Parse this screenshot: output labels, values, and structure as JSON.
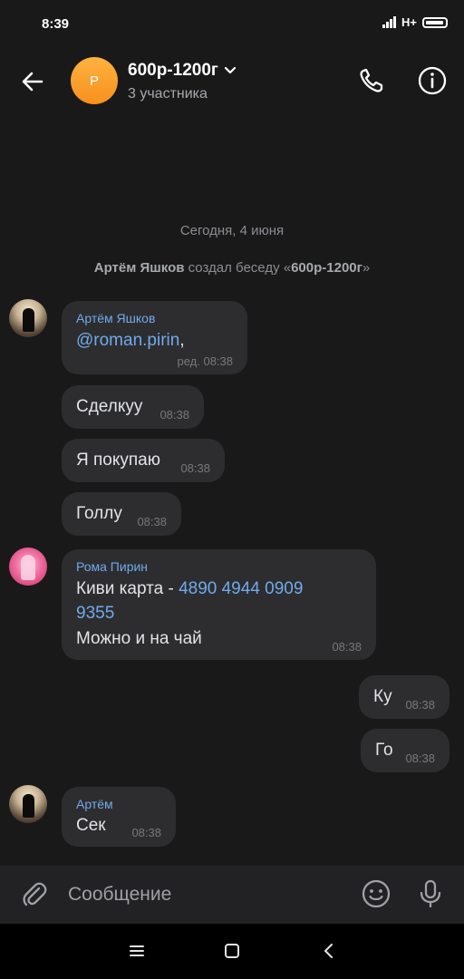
{
  "status": {
    "time": "8:39",
    "network": "H+"
  },
  "header": {
    "avatar_letter": "Р",
    "title": "600р-1200г",
    "subtitle": "3 участника"
  },
  "date_separator": "Сегодня, 4 июня",
  "service": {
    "actor": "Артём Яшков",
    "action": " создал беседу «",
    "chat_name": "600р-1200г",
    "close": "»"
  },
  "messages": {
    "m1": {
      "sender": "Артём Яшков",
      "mention": "@roman.pirin",
      "tail": ",",
      "time": "ред. 08:38"
    },
    "m2": {
      "text": "Сделкуу",
      "time": "08:38"
    },
    "m3": {
      "text": "Я покупаю",
      "time": "08:38"
    },
    "m4": {
      "text": "Голлу",
      "time": "08:38"
    },
    "m5": {
      "sender": "Рома Пирин",
      "prefix": "Киви карта - ",
      "card_1": "4890 4944 0909",
      "card_2": "9355",
      "line3": "Можно и на чай",
      "time": "08:38"
    },
    "m6": {
      "text": "Ку",
      "time": "08:38"
    },
    "m7": {
      "text": "Го",
      "time": "08:38"
    },
    "m8": {
      "sender": "Артём",
      "text": "Сек",
      "time": "08:38"
    }
  },
  "composer": {
    "placeholder": "Сообщение"
  },
  "colors": {
    "background": "#19191a",
    "bubble": "#2d2d2f",
    "link": "#71aaeb",
    "avatar_orange": "#f7901e"
  },
  "icons": [
    "back-arrow-icon",
    "chevron-down-icon",
    "phone-icon",
    "info-icon",
    "paperclip-icon",
    "emoji-icon",
    "microphone-icon",
    "menu-icon",
    "home-square-icon",
    "back-triangle-icon"
  ]
}
